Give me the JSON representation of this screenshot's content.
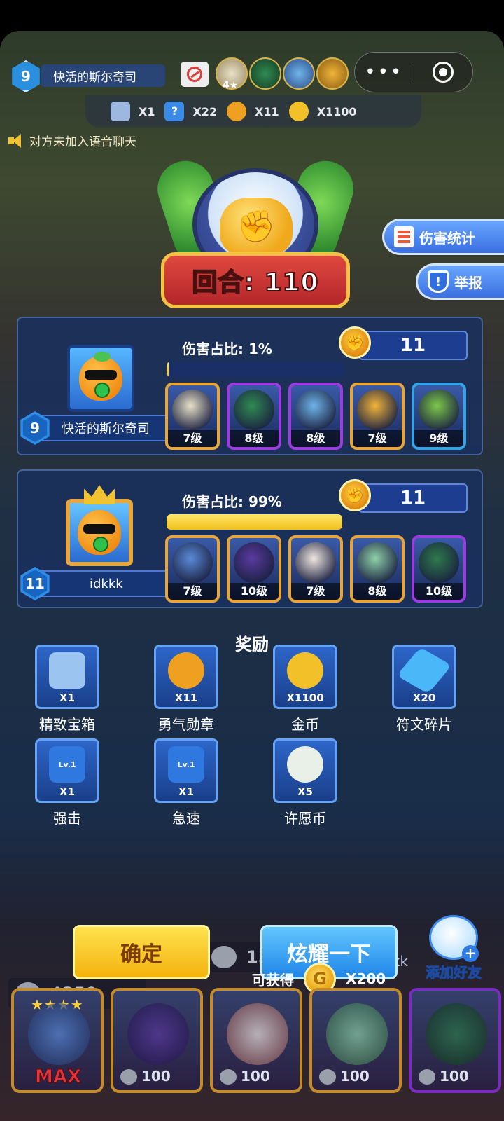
{
  "hud": {
    "opponent_level": "9",
    "opponent_name": "快活的斯尔奇司",
    "hero_star_count": "4",
    "resources": [
      {
        "icon": "chest-icon",
        "qty": "X1"
      },
      {
        "icon": "question-icon",
        "qty": "X22"
      },
      {
        "icon": "medal-icon",
        "qty": "X11"
      },
      {
        "icon": "coin-icon",
        "qty": "X1100"
      }
    ],
    "voice_note": "对方未加入语音聊天",
    "mini_program_more": "•••"
  },
  "emblem": {
    "round_label": "回合: 110"
  },
  "side_buttons": {
    "damage_stats": "伤害统计",
    "report": "举报"
  },
  "players": [
    {
      "level": "9",
      "name": "快活的斯尔奇司",
      "damage_label": "伤害占比:",
      "damage_pct_text": "1%",
      "damage_fraction": 0.01,
      "medals": "11",
      "heroes": [
        {
          "level": "7级",
          "rarity": "gold",
          "color": "#e8e0c8"
        },
        {
          "level": "8级",
          "rarity": "purple",
          "color": "#2f8a52"
        },
        {
          "level": "8级",
          "rarity": "purple",
          "color": "#6fb4e8"
        },
        {
          "level": "7级",
          "rarity": "gold",
          "color": "#f0b43a"
        },
        {
          "level": "9级",
          "rarity": "blue",
          "color": "#7cc84a"
        }
      ]
    },
    {
      "level": "11",
      "name": "idkkk",
      "damage_label": "伤害占比:",
      "damage_pct_text": "99%",
      "damage_fraction": 0.99,
      "medals": "11",
      "heroes": [
        {
          "level": "7级",
          "rarity": "gold",
          "color": "#5a8ad8"
        },
        {
          "level": "10级",
          "rarity": "gold",
          "color": "#5a3aa0"
        },
        {
          "level": "7级",
          "rarity": "gold",
          "color": "#f0e6e0"
        },
        {
          "level": "8级",
          "rarity": "gold",
          "color": "#8ed0a8"
        },
        {
          "level": "10级",
          "rarity": "purple",
          "color": "#2d7a4a"
        }
      ]
    }
  ],
  "rewards": {
    "title": "奖励",
    "items": [
      {
        "name": "精致宝箱",
        "qty": "X1",
        "icon": "chest-icon",
        "color": "#9cc4f0"
      },
      {
        "name": "勇气勋章",
        "qty": "X11",
        "icon": "medal-icon",
        "color": "#f0a020"
      },
      {
        "name": "金币",
        "qty": "X1100",
        "icon": "coin-icon",
        "color": "#f2c028"
      },
      {
        "name": "符文碎片",
        "qty": "X20",
        "icon": "crystal-icon",
        "color": "#4ab8f8"
      },
      {
        "name": "强击",
        "qty": "X1",
        "sub": "Lv.1",
        "icon": "strike-rune-icon",
        "color": "#2e78e0"
      },
      {
        "name": "急速",
        "qty": "X1",
        "sub": "Lv.1",
        "icon": "haste-rune-icon",
        "color": "#2e78e0"
      },
      {
        "name": "许愿币",
        "qty": "X5",
        "icon": "clover-coin-icon",
        "color": "#e8f0e8"
      }
    ]
  },
  "actions": {
    "confirm": "确定",
    "show_off": "炫耀一下",
    "add_friend": "添加好友",
    "gain_label": "可获得",
    "gain_qty": "X200"
  },
  "background": {
    "score_left": "4350",
    "score_mid": "1570",
    "name_right": "idkkk",
    "card_costs": [
      "100",
      "100",
      "100",
      "100"
    ],
    "max_label": "MAX"
  }
}
